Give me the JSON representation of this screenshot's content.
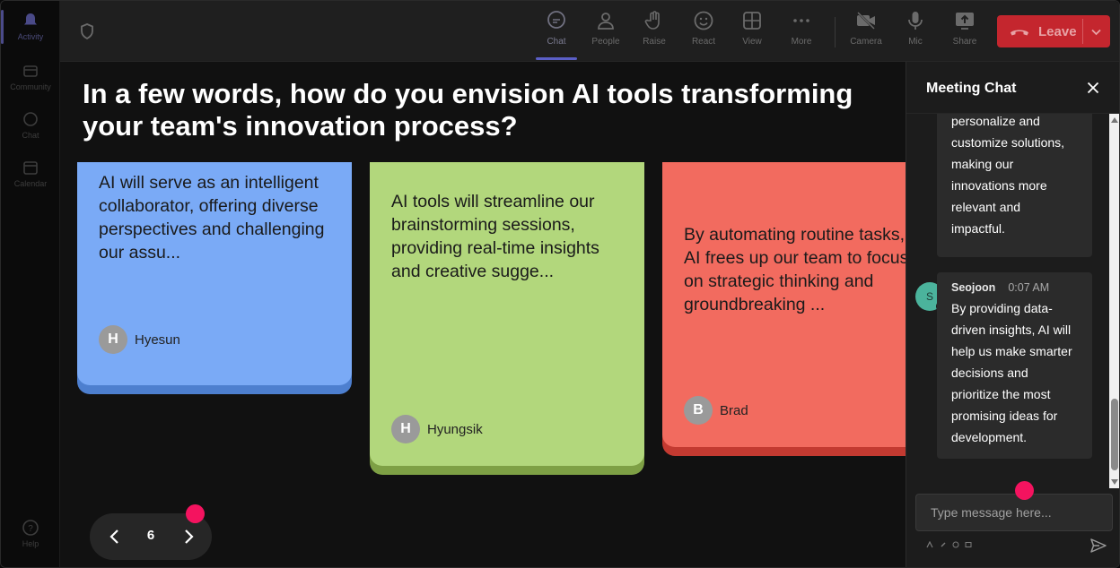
{
  "rail": {
    "items": [
      {
        "label": "Activity",
        "icon": "bell-icon"
      },
      {
        "label": "Community",
        "icon": "community-icon"
      },
      {
        "label": "Chat",
        "icon": "chat-icon"
      },
      {
        "label": "Calendar",
        "icon": "calendar-icon"
      },
      {
        "label": "Help",
        "icon": "help-icon"
      }
    ]
  },
  "toolbar": {
    "chat": "Chat",
    "people": "People",
    "raise": "Raise",
    "react": "React",
    "view": "View",
    "more": "More",
    "camera": "Camera",
    "mic": "Mic",
    "share": "Share",
    "leave": "Leave"
  },
  "question": "In a few words, how do you envision AI tools transforming your team's innovation process?",
  "cards": [
    {
      "text": "AI will serve as an intelligent collaborator, offering diverse perspectives and challenging our assu...",
      "initial": "H",
      "author": "Hyesun",
      "color": "#7aaaf6"
    },
    {
      "text": "AI tools will streamline our brainstorming sessions, providing real-time insights and creative sugge...",
      "initial": "H",
      "author": "Hyungsik",
      "color": "#b2d77c"
    },
    {
      "text_lines": [
        "By automating routine tasks,",
        "AI frees up our team to focus",
        "on strategic thinking and",
        "groundbreaking ..."
      ],
      "initial": "B",
      "author": "Brad",
      "color": "#f26b5f"
    }
  ],
  "pager": {
    "page": "6"
  },
  "chat": {
    "title": "Meeting Chat",
    "messages": [
      {
        "text_lines": [
          "personalize and",
          "customize solutions,",
          "making our",
          "innovations more",
          "relevant and",
          "impactful."
        ]
      },
      {
        "avatar": "S",
        "name": "Seojoon",
        "time": "0:07 AM",
        "text_lines": [
          "By providing data-",
          "driven insights, AI will",
          "help us make smarter",
          "decisions and",
          "prioritize the most",
          "promising ideas for",
          "development."
        ]
      }
    ],
    "input_placeholder": "Type message here..."
  },
  "colors": {
    "accent": "#5b5fc7",
    "leave": "#c4262e",
    "marker": "#f4135f"
  }
}
